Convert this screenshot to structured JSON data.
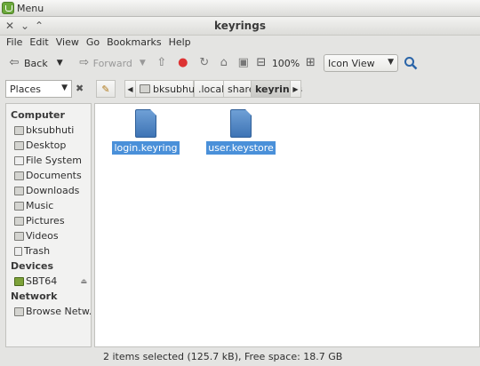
{
  "panel": {
    "menu_label": "Menu"
  },
  "window": {
    "title": "keyrings",
    "close_glyph": "✕",
    "minimize_glyph": "⌄",
    "maximize_glyph": "⌃"
  },
  "menubar": [
    "File",
    "Edit",
    "View",
    "Go",
    "Bookmarks",
    "Help"
  ],
  "toolbar": {
    "back_label": "Back",
    "forward_label": "Forward",
    "zoom": "100%",
    "view_mode": "Icon View"
  },
  "location": {
    "places_label": "Places",
    "breadcrumbs": [
      "bksubhuti",
      ".local",
      "share",
      "keyrings"
    ]
  },
  "sidebar": {
    "computer_heading": "Computer",
    "computer_items": [
      "bksubhuti",
      "Desktop",
      "File System",
      "Documents",
      "Downloads",
      "Music",
      "Pictures",
      "Videos",
      "Trash"
    ],
    "devices_heading": "Devices",
    "device_items": [
      "SBT64"
    ],
    "network_heading": "Network",
    "network_items": [
      "Browse Netw..."
    ]
  },
  "files": [
    {
      "name": "login.keyring",
      "selected": true
    },
    {
      "name": "user.keystore",
      "selected": true
    }
  ],
  "status": "2 items selected (125.7 kB), Free space: 18.7 GB",
  "colors": {
    "selection": "#4a90d9",
    "file_icon": "#3e74b5"
  }
}
